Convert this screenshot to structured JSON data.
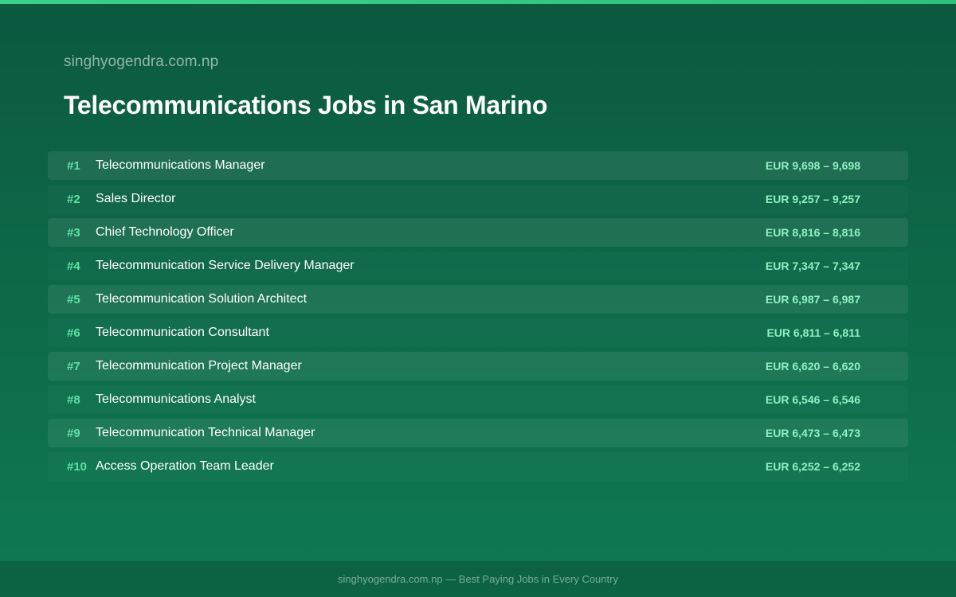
{
  "brand": "singhyogendra.com.np",
  "title": "Telecommunications Jobs in San Marino",
  "jobs": [
    {
      "rank": "#1",
      "title": "Telecommunications Manager",
      "salary": "EUR 9,698 – 9,698"
    },
    {
      "rank": "#2",
      "title": "Sales Director",
      "salary": "EUR 9,257 – 9,257"
    },
    {
      "rank": "#3",
      "title": "Chief Technology Officer",
      "salary": "EUR 8,816 – 8,816"
    },
    {
      "rank": "#4",
      "title": "Telecommunication Service Delivery Manager",
      "salary": "EUR 7,347 – 7,347"
    },
    {
      "rank": "#5",
      "title": "Telecommunication Solution Architect",
      "salary": "EUR 6,987 – 6,987"
    },
    {
      "rank": "#6",
      "title": "Telecommunication Consultant",
      "salary": "EUR 6,811 – 6,811"
    },
    {
      "rank": "#7",
      "title": "Telecommunication Project Manager",
      "salary": "EUR 6,620 – 6,620"
    },
    {
      "rank": "#8",
      "title": "Telecommunications Analyst",
      "salary": "EUR 6,546 – 6,546"
    },
    {
      "rank": "#9",
      "title": "Telecommunication Technical Manager",
      "salary": "EUR 6,473 – 6,473"
    },
    {
      "rank": "#10",
      "title": "Access Operation Team Leader",
      "salary": "EUR 6,252 – 6,252"
    }
  ],
  "footer": "singhyogendra.com.np — Best Paying Jobs in Every Country",
  "colors": {
    "background": "#0d6647",
    "accent_bar": "#3ad08a",
    "rank": "#5fe0a5",
    "salary": "#8ff0c0"
  }
}
